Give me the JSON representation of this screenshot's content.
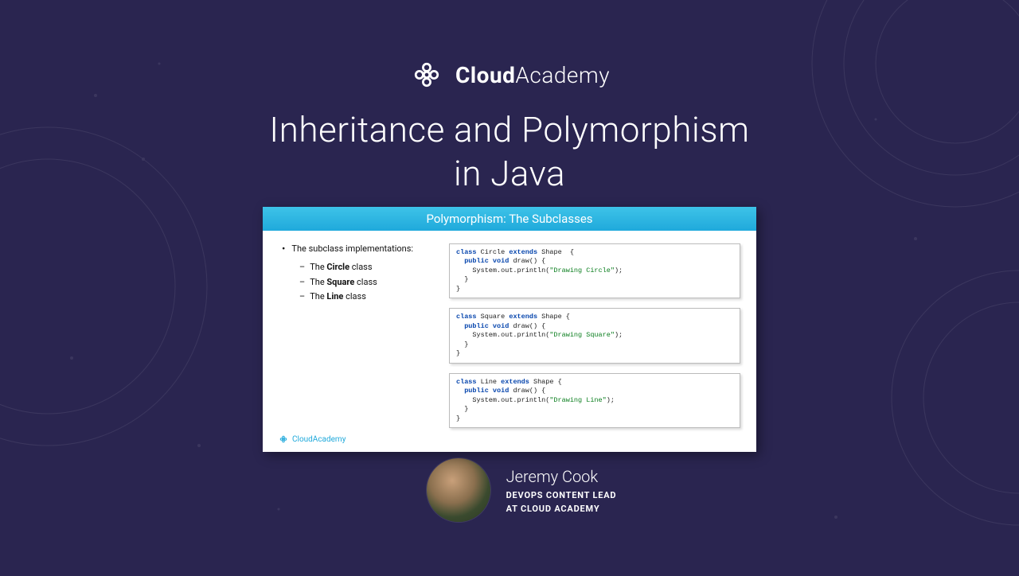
{
  "brand": {
    "bold": "Cloud",
    "light": "Academy"
  },
  "title": {
    "line1": "Inheritance and Polymorphism",
    "line2": "in Java"
  },
  "slide": {
    "header": "Polymorphism: The Subclasses",
    "main_bullet": "The subclass implementations:",
    "subs": {
      "a_pre": "The ",
      "a_bold": "Circle",
      "a_post": " class",
      "b_pre": "The ",
      "b_bold": "Square",
      "b_post": " class",
      "c_pre": "The ",
      "c_bold": "Line",
      "c_post": " class"
    },
    "code": {
      "circle": {
        "cls": "Circle",
        "sup": "Shape",
        "msg": "\"Drawing Circle\""
      },
      "square": {
        "cls": "Square",
        "sup": "Shape",
        "msg": "\"Drawing Square\""
      },
      "line": {
        "cls": "Line",
        "sup": "Shape",
        "msg": "\"Drawing Line\""
      },
      "kw": {
        "class": "class",
        "extends": "extends",
        "public": "public",
        "void": "void",
        "draw": "draw()",
        "sysout": "System.out.println("
      }
    },
    "footer_brand": "CloudAcademy"
  },
  "author": {
    "name": "Jeremy Cook",
    "role_l1": "DEVOPS CONTENT LEAD",
    "role_l2": "AT CLOUD ACADEMY"
  }
}
